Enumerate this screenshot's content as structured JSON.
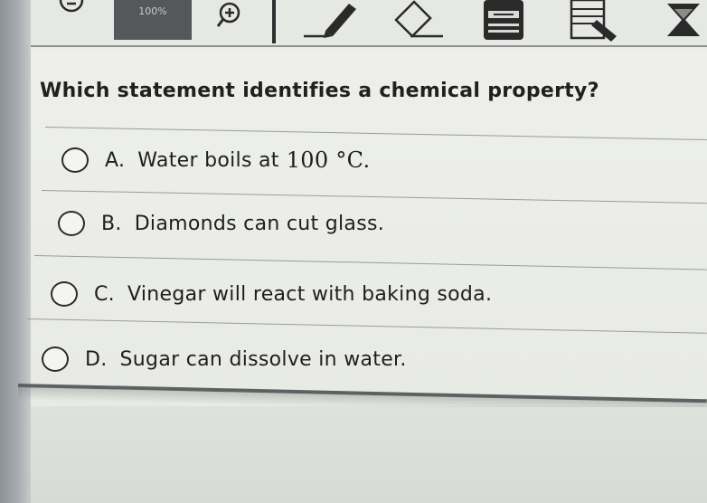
{
  "toolbar": {
    "zoom_value": "100%",
    "icons": {
      "zoom_out": "zoom-out-icon",
      "zoom_in": "zoom-in-icon",
      "pen": "pen-icon",
      "eraser": "eraser-icon",
      "calculator": "calculator-icon",
      "notes": "notes-icon",
      "close": "close-icon"
    }
  },
  "question": {
    "text": "Which statement identifies a chemical property?",
    "choices": [
      {
        "letter": "A.",
        "text": "Water boils at",
        "value": "100 °C."
      },
      {
        "letter": "B.",
        "text": "Diamonds can cut glass."
      },
      {
        "letter": "C.",
        "text": "Vinegar will react with baking soda."
      },
      {
        "letter": "D.",
        "text": "Sugar can dissolve in water."
      }
    ]
  },
  "colors": {
    "toolbar_bg": "#e6e8e4",
    "zoom_box": "#55585a",
    "text": "#202020",
    "separator": "#9a9c99"
  }
}
